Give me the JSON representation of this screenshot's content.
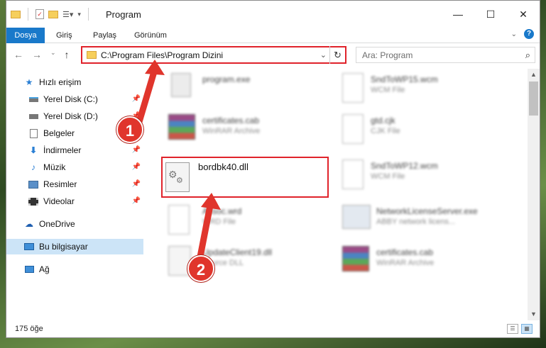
{
  "window": {
    "title": "Program",
    "controls": [
      "—",
      "☐",
      "✕"
    ]
  },
  "ribbon": {
    "tabs": [
      "Dosya",
      "Giriş",
      "Paylaş",
      "Görünüm"
    ]
  },
  "address_bar": {
    "path": "C:\\Program Files\\Program Dizini"
  },
  "search": {
    "placeholder": "Ara: Program"
  },
  "sidebar": {
    "items": [
      {
        "label": "Hızlı erişim",
        "icon": "star-icon",
        "pinned": false
      },
      {
        "label": "Yerel Disk (C:)",
        "icon": "drive-icon",
        "pinned": true
      },
      {
        "label": "Yerel Disk (D:)",
        "icon": "drive-icon",
        "pinned": true
      },
      {
        "label": "Belgeler",
        "icon": "documents-icon",
        "pinned": true
      },
      {
        "label": "İndirmeler",
        "icon": "download-icon",
        "pinned": true
      },
      {
        "label": "Müzik",
        "icon": "music-icon",
        "pinned": true
      },
      {
        "label": "Resimler",
        "icon": "pictures-icon",
        "pinned": true
      },
      {
        "label": "Videolar",
        "icon": "videos-icon",
        "pinned": true
      },
      {
        "label": "OneDrive",
        "icon": "cloud-icon",
        "pinned": false
      },
      {
        "label": "Bu bilgisayar",
        "icon": "computer-icon",
        "pinned": false,
        "selected": true
      },
      {
        "label": "Ağ",
        "icon": "network-icon",
        "pinned": false
      }
    ]
  },
  "files": [
    {
      "name": "program.exe",
      "type": "",
      "icon": "exe-icon",
      "blurred": true
    },
    {
      "name": "SndToWP15.wcm",
      "type": "WCM File",
      "icon": "file-icon",
      "blurred": true
    },
    {
      "name": "certificates.cab",
      "type": "WinRAR Archive",
      "icon": "winrar-icon",
      "blurred": true
    },
    {
      "name": "gtd.cjk",
      "type": "CJK File",
      "icon": "file-icon",
      "blurred": true
    },
    {
      "name": "bordbk40.dll",
      "type": "",
      "icon": "dll-icon",
      "blurred": false
    },
    {
      "name": "SndToWP12.wcm",
      "type": "WCM File",
      "icon": "file-icon",
      "blurred": true
    },
    {
      "name": "Assoc.wrd",
      "type": "WRD File",
      "icon": "file-icon",
      "blurred": true
    },
    {
      "name": "NetworkLicenseServer.exe",
      "type": "ABBY network licens...",
      "icon": "exe-icon",
      "blurred": true
    },
    {
      "name": "UpdateClient19.dll",
      "type": "Source DLL",
      "icon": "dll-icon",
      "blurred": true
    },
    {
      "name": "certificates.cab",
      "type": "WinRAR Archive",
      "icon": "winrar-icon",
      "blurred": true
    }
  ],
  "status": {
    "item_count": "175 öğe"
  },
  "callouts": [
    "1",
    "2"
  ],
  "colors": {
    "accent": "#1979ca",
    "highlight": "#e0232b",
    "selected": "#cce4f7"
  }
}
